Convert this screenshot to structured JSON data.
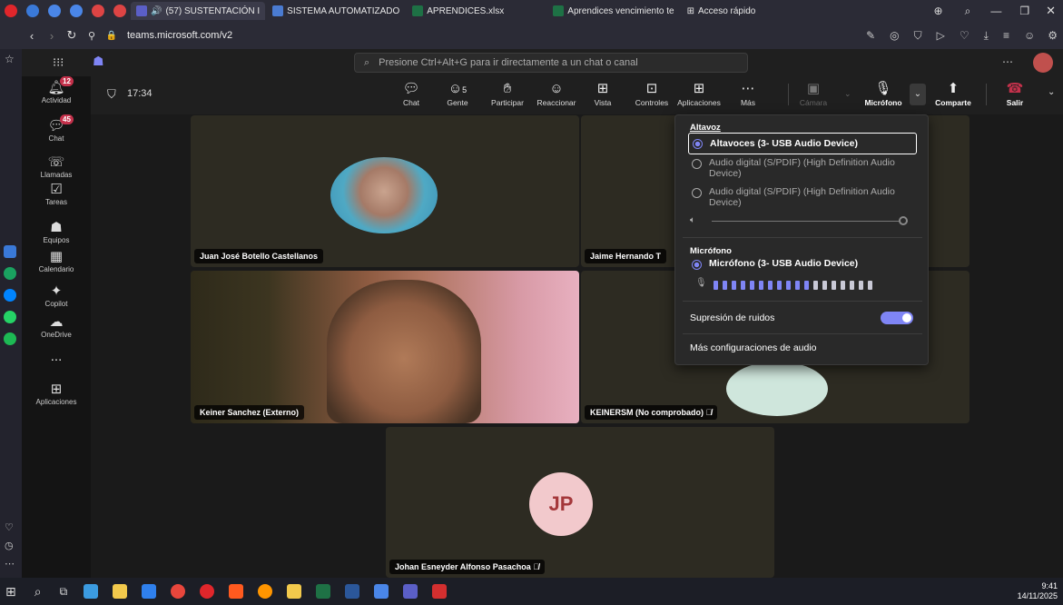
{
  "browser": {
    "tabs": [
      {
        "label": "(57) SUSTENTACIÓN I",
        "color": "#5b5fc7",
        "active": true
      },
      {
        "label": "SISTEMA AUTOMATIZADO",
        "color": "#4a7bd1",
        "active": false
      },
      {
        "label": "APRENDICES.xlsx",
        "color": "#1e7145",
        "active": false
      },
      {
        "label": "Aprendices vencimiento te",
        "color": "#1e7145",
        "active": false
      },
      {
        "label": "Acceso rápido",
        "color": "#888888",
        "active": false
      }
    ],
    "url": "teams.microsoft.com/v2"
  },
  "teams": {
    "search_placeholder": "Presione Ctrl+Alt+G para ir directamente a un chat o canal",
    "rail": [
      {
        "label": "Actividad",
        "icon": "bell-icon",
        "badge": "12"
      },
      {
        "label": "Chat",
        "icon": "chat-icon",
        "badge": "45"
      },
      {
        "label": "Llamadas",
        "icon": "phone-icon",
        "badge": ""
      },
      {
        "label": "Tareas",
        "icon": "tasks-icon",
        "badge": ""
      },
      {
        "label": "Equipos",
        "icon": "teams-icon",
        "badge": ""
      },
      {
        "label": "Calendario",
        "icon": "calendar-icon",
        "badge": ""
      },
      {
        "label": "Copilot",
        "icon": "copilot-icon",
        "badge": ""
      },
      {
        "label": "OneDrive",
        "icon": "cloud-icon",
        "badge": ""
      },
      {
        "label": "...",
        "icon": "more-icon",
        "badge": ""
      },
      {
        "label": "Aplicaciones",
        "icon": "apps-icon",
        "badge": ""
      }
    ],
    "meeting": {
      "timer": "17:34",
      "toolbar": {
        "chat": "Chat",
        "people": "Gente",
        "people_count": "5",
        "raise": "Participar",
        "react": "Reaccionar",
        "view": "Vista",
        "controls": "Controles",
        "apps": "Aplicaciones",
        "more": "Más",
        "camera": "Cámara",
        "mic": "Micrófono",
        "share": "Comparte",
        "leave": "Salir"
      }
    },
    "participants": [
      {
        "name": "Juan José Botello Castellanos"
      },
      {
        "name": "Jaime Hernando T"
      },
      {
        "name": "Keiner Sanchez (Externo)"
      },
      {
        "name": "KEINERSM (No comprobado)"
      },
      {
        "name": "Johan Esneyder Alfonso Pasachoa",
        "initials": "JP"
      }
    ],
    "audio_popup": {
      "speaker_title": "Altavoz",
      "speaker_opts": [
        "Altavoces (3- USB Audio Device)",
        "Audio digital (S/PDIF) (High Definition Audio Device)",
        "Audio digital (S/PDIF) (High Definition Audio Device)"
      ],
      "mic_title": "Micrófono",
      "mic_opt": "Micrófono (3- USB Audio Device)",
      "noise": "Supresión de ruidos",
      "noise_on": true,
      "more": "Más configuraciones de audio"
    }
  },
  "taskbar": {
    "time": "9:41",
    "date": "14/11/2025"
  },
  "colors": {
    "accent": "#7f85f5",
    "leave": "#c4314b"
  }
}
